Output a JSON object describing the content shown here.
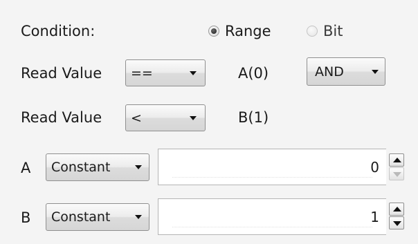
{
  "condition": {
    "label": "Condition:",
    "options": [
      {
        "label": "Range",
        "selected": true
      },
      {
        "label": "Bit",
        "selected": false
      }
    ]
  },
  "rows": [
    {
      "label": "Read Value",
      "operator": "==",
      "operand": "A(0)",
      "logic": "AND"
    },
    {
      "label": "Read Value",
      "operator": "<",
      "operand": "B(1)"
    }
  ],
  "inputs": [
    {
      "label": "A",
      "source": "Constant",
      "value": "0",
      "down_enabled": false
    },
    {
      "label": "B",
      "source": "Constant",
      "value": "1",
      "down_enabled": true
    }
  ],
  "icons": {
    "dropdown": "chevron-down-icon",
    "spin_up": "triangle-up-icon",
    "spin_down": "triangle-down-icon"
  }
}
